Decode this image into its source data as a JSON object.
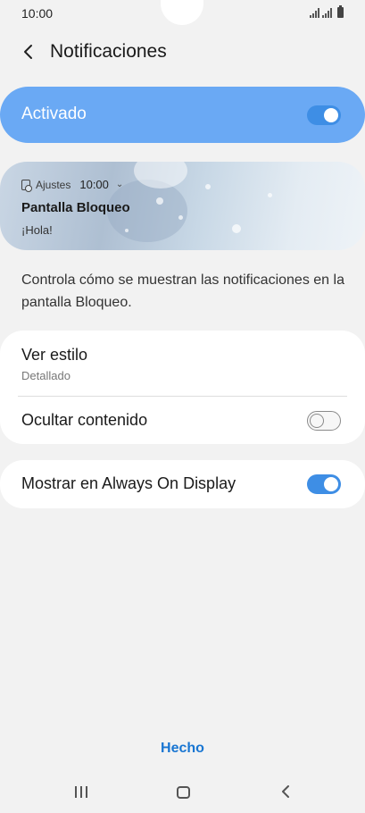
{
  "status_bar": {
    "time": "10:00"
  },
  "header": {
    "title": "Notificaciones"
  },
  "master": {
    "label": "Activado",
    "enabled": true
  },
  "preview": {
    "app_name": "Ajustes",
    "time": "10:00",
    "title": "Pantalla Bloqueo",
    "body": "¡Hola!"
  },
  "description": "Controla cómo se muestran las notificaciones en la pantalla Bloqueo.",
  "settings": {
    "view_style": {
      "label": "Ver estilo",
      "value": "Detallado"
    },
    "hide_content": {
      "label": "Ocultar contenido",
      "enabled": false
    },
    "always_on_display": {
      "label": "Mostrar en Always On Display",
      "enabled": true
    }
  },
  "footer": {
    "done_label": "Hecho"
  },
  "colors": {
    "accent": "#3e8ee5",
    "master_bar": "#6aa9f4",
    "done_link": "#1976d2"
  },
  "icons": {
    "back": "chevron-left-icon",
    "nav_recents": "recents-icon",
    "nav_home": "home-icon",
    "nav_back": "back-icon"
  }
}
